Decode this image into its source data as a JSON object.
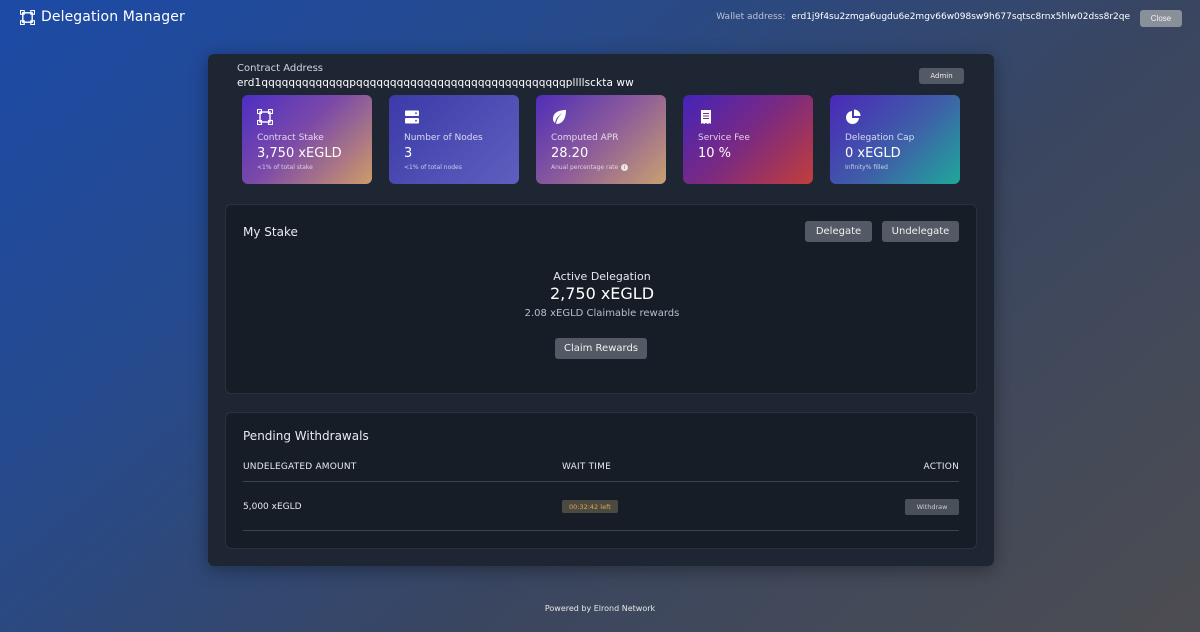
{
  "header": {
    "title": "Delegation Manager",
    "wallet_label": "Wallet address:",
    "wallet_address": "erd1j9f4su2zmga6ugdu6e2mgv66w098sw9h677sqtsc8rnx5hlw02dss8r2qe",
    "close_label": "Close",
    "brand_icon": "logo-icon"
  },
  "contract": {
    "label": "Contract Address",
    "address": "erd1qqqqqqqqqqqqqpqqqqqqqqqqqqqqqqqqqqqqqqqqqqqqqpllllsckta ww",
    "admin_label": "Admin"
  },
  "cards": [
    {
      "icon": "contract-stake-icon",
      "label": "Contract Stake",
      "value": "3,750 xEGLD",
      "note": "<1% of total stake"
    },
    {
      "icon": "server-icon",
      "label": "Number of Nodes",
      "value": "3",
      "note": "<1% of total nodes"
    },
    {
      "icon": "leaf-icon",
      "label": "Computed APR",
      "value": "28.20",
      "note": "Anual percentage rate"
    },
    {
      "icon": "receipt-icon",
      "label": "Service Fee",
      "value": "10 %",
      "note": ""
    },
    {
      "icon": "pie-chart-icon",
      "label": "Delegation Cap",
      "value": "0 xEGLD",
      "note": "Infinity% filled"
    }
  ],
  "my_stake": {
    "title": "My Stake",
    "delegate_label": "Delegate",
    "undelegate_label": "Undelegate",
    "active_label": "Active Delegation",
    "active_value": "2,750 xEGLD",
    "claimable": "2.08 xEGLD Claimable rewards",
    "claim_label": "Claim Rewards"
  },
  "withdrawals": {
    "title": "Pending Withdrawals",
    "columns": [
      "UNDELEGATED AMOUNT",
      "WAIT TIME",
      "ACTION"
    ],
    "rows": [
      {
        "amount": "5,000 xEGLD",
        "wait": "00:32:42 left",
        "action": "Withdraw"
      }
    ]
  },
  "footer": {
    "text": "Powered by Elrond Network"
  },
  "colors": {
    "accent_wait": "#e0a84a",
    "panel": "#1f2633",
    "box": "#171d27"
  }
}
